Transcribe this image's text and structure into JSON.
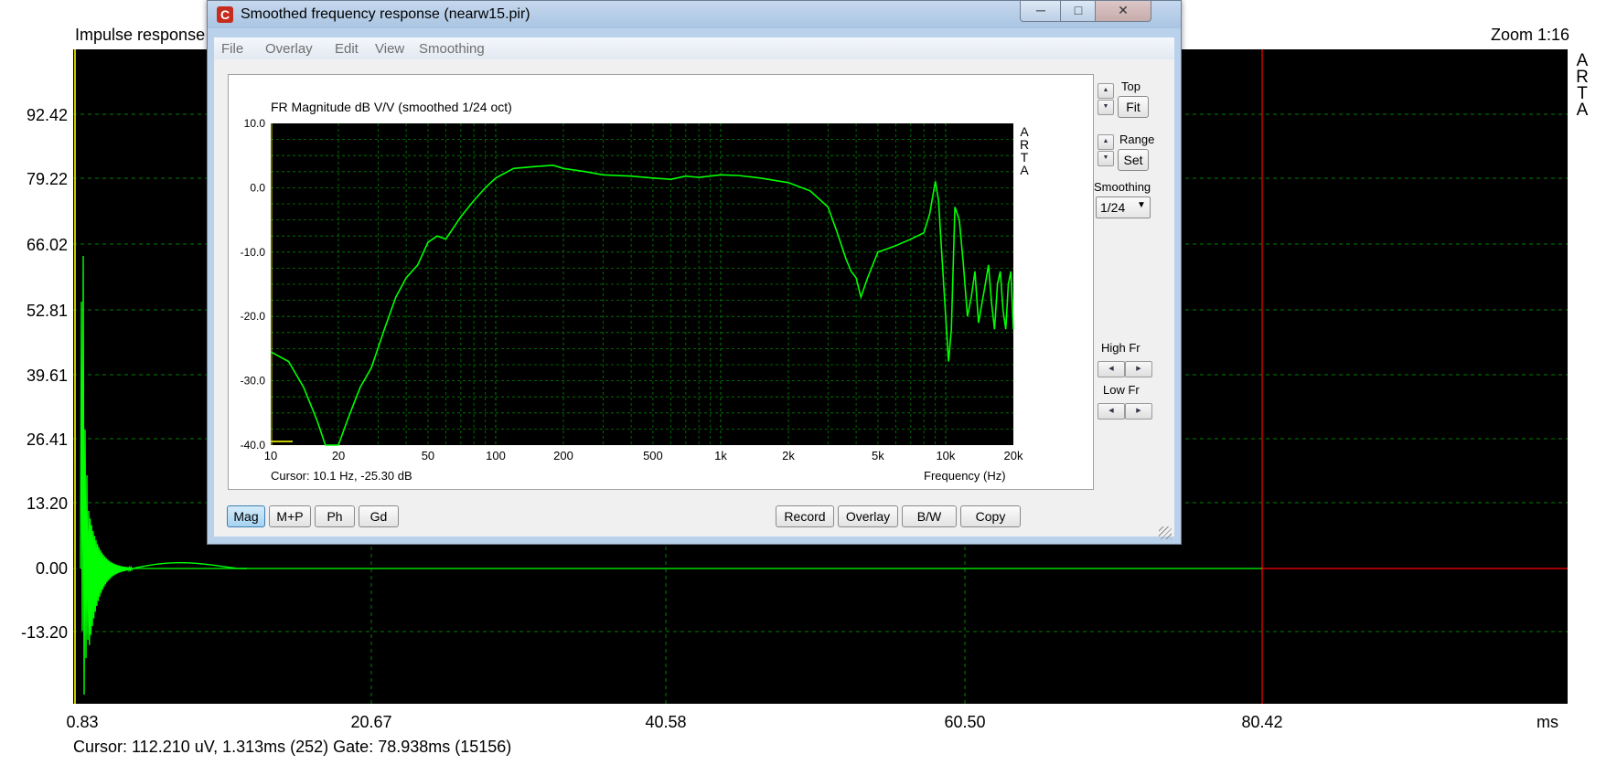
{
  "impulse": {
    "title": "Impulse response",
    "zoom": "Zoom 1:16",
    "arta": "A\nR\nT\nA",
    "y_ticks": [
      "92.42",
      "79.22",
      "66.02",
      "52.81",
      "39.61",
      "26.41",
      "13.20",
      "0.00",
      "-13.20"
    ],
    "x_ticks": [
      "0.83",
      "20.67",
      "40.58",
      "60.50",
      "80.42"
    ],
    "x_unit": "ms",
    "cursor": "Cursor: 112.210 uV, 1.313ms (252)  Gate: 78.938ms (15156)",
    "colors": {
      "trace": "#00ff00",
      "grid": "#008000",
      "gate": "#ff0000",
      "background": "#000000"
    }
  },
  "window": {
    "title": "Smoothed frequency response (nearw15.pir)",
    "icon": "arta-app-icon",
    "menu": [
      "File",
      "Overlay",
      "Edit",
      "View",
      "Smoothing"
    ]
  },
  "fr": {
    "title": "FR Magnitude dB V/V (smoothed 1/24 oct)",
    "arta": "A\nR\nT\nA",
    "cursor": "Cursor: 10.1 Hz, -25.30 dB",
    "xlabel": "Frequency (Hz)"
  },
  "chart_data": {
    "type": "line",
    "title": "FR Magnitude dB V/V (smoothed 1/24 oct)",
    "xlabel": "Frequency (Hz)",
    "ylabel": "",
    "x_scale": "log",
    "xlim": [
      10,
      20000
    ],
    "ylim": [
      -40,
      10
    ],
    "x_tick_labels": [
      "10",
      "20",
      "50",
      "100",
      "200",
      "500",
      "1k",
      "2k",
      "5k",
      "10k",
      "20k"
    ],
    "x_tick_values": [
      10,
      20,
      50,
      100,
      200,
      500,
      1000,
      2000,
      5000,
      10000,
      20000
    ],
    "y_tick_labels": [
      "10.0",
      "0.0",
      "-10.0",
      "-20.0",
      "-30.0",
      "-40.0"
    ],
    "y_tick_values": [
      10,
      0,
      -10,
      -20,
      -30,
      -40
    ],
    "grid": true,
    "series": [
      {
        "x": [
          10,
          12,
          14,
          16,
          17.5,
          20,
          22,
          25,
          28,
          32,
          36,
          40,
          45,
          50,
          55,
          60,
          70,
          80,
          90,
          100,
          120,
          150,
          180,
          200,
          250,
          300,
          400,
          500,
          600,
          700,
          800,
          1000,
          1200,
          1500,
          2000,
          2500,
          3000,
          3300,
          3600,
          3800,
          4000,
          4200,
          4500,
          5000,
          5500,
          6000,
          7000,
          8000,
          8500,
          9000,
          9300,
          9600,
          10000,
          10300,
          10600,
          11000,
          11500,
          12000,
          12500,
          13000,
          13500,
          14000,
          14500,
          15000,
          15500,
          16000,
          16500,
          17000,
          17500,
          18000,
          18500,
          19000,
          19500,
          20000
        ],
        "y": [
          -25.5,
          -27,
          -31,
          -36,
          -40,
          -40,
          -36,
          -31,
          -28,
          -22,
          -17,
          -14,
          -12,
          -8.5,
          -7.5,
          -8,
          -4.5,
          -2,
          0,
          1.5,
          3,
          3.3,
          3.5,
          3,
          2.5,
          2,
          1.8,
          1.5,
          1.3,
          1.8,
          1.6,
          2,
          1.9,
          1.5,
          0.8,
          -0.5,
          -3,
          -7,
          -11,
          -13,
          -14,
          -17,
          -14,
          -10,
          -9.5,
          -9,
          -8,
          -7,
          -4,
          1,
          -2,
          -10,
          -20,
          -27,
          -22,
          -3,
          -5,
          -12,
          -20,
          -17,
          -13,
          -21,
          -18,
          -15,
          -12,
          -18,
          -22,
          -15,
          -13,
          -19,
          -22,
          -15,
          -13,
          -22
        ]
      }
    ],
    "colors": {
      "trace": "#00ff00",
      "grid": "#008000",
      "marker": "#c8c800"
    }
  },
  "right_panel": {
    "top_label": "Top",
    "fit_label": "Fit",
    "range_label": "Range",
    "set_label": "Set",
    "smoothing_label": "Smoothing",
    "smoothing_value": "1/24",
    "high_fr_label": "High Fr",
    "low_fr_label": "Low Fr"
  },
  "bottom_buttons": {
    "mag": "Mag",
    "mp": "M+P",
    "ph": "Ph",
    "gd": "Gd",
    "record": "Record",
    "overlay": "Overlay",
    "bw": "B/W",
    "copy": "Copy"
  }
}
